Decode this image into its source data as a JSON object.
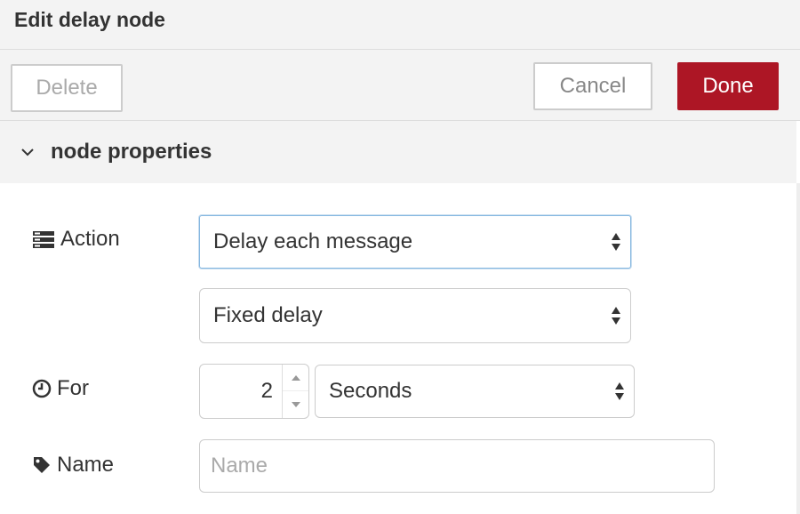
{
  "dialog": {
    "title": "Edit delay node"
  },
  "toolbar": {
    "delete_label": "Delete",
    "cancel_label": "Cancel",
    "done_label": "Done"
  },
  "section": {
    "label": "node properties",
    "icon": "chevron-down-icon"
  },
  "form": {
    "action": {
      "label": "Action",
      "icon": "list-icon",
      "selected": "Delay each message",
      "secondary_selected": "Fixed delay"
    },
    "for": {
      "label": "For",
      "icon": "clock-icon",
      "value": "2",
      "units_selected": "Seconds"
    },
    "name": {
      "label": "Name",
      "icon": "tag-icon",
      "value": "",
      "placeholder": "Name"
    }
  },
  "colors": {
    "primary": "#ad1625",
    "header_bg": "#f3f3f3",
    "focus_border": "#85b7e0"
  }
}
